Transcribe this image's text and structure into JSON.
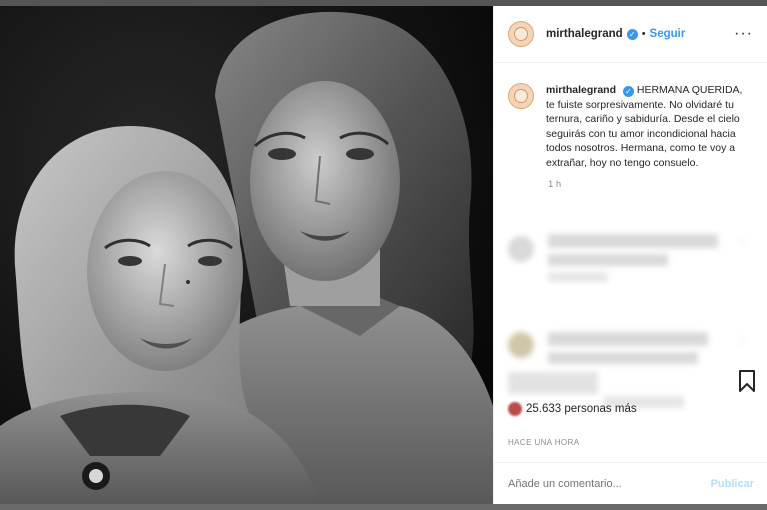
{
  "post": {
    "username": "mirthalegrand",
    "verified_icon": "verified-badge-icon",
    "follow_label": "Seguir",
    "separator": "•",
    "more_label": "···"
  },
  "caption": {
    "username": "mirthalegrand",
    "text": "HERMANA QUERIDA, te fuiste sorpresivamente. No olvidaré tu ternura, cariño y sabiduría. Desde el cielo seguirás con tu amor incondicional hacia todos nosotros. Hermana, como te voy a extrañar, hoy no tengo consuelo.",
    "time": "1 h"
  },
  "likes": {
    "text": "25.633 personas más"
  },
  "timestamp": "HACE UNA HORA",
  "comment": {
    "placeholder": "Añade un comentario...",
    "publish_label": "Publicar"
  },
  "colors": {
    "accent": "#3897f0",
    "publish_disabled": "#b2dffc",
    "text": "#262626",
    "muted": "#8e8e8e"
  }
}
